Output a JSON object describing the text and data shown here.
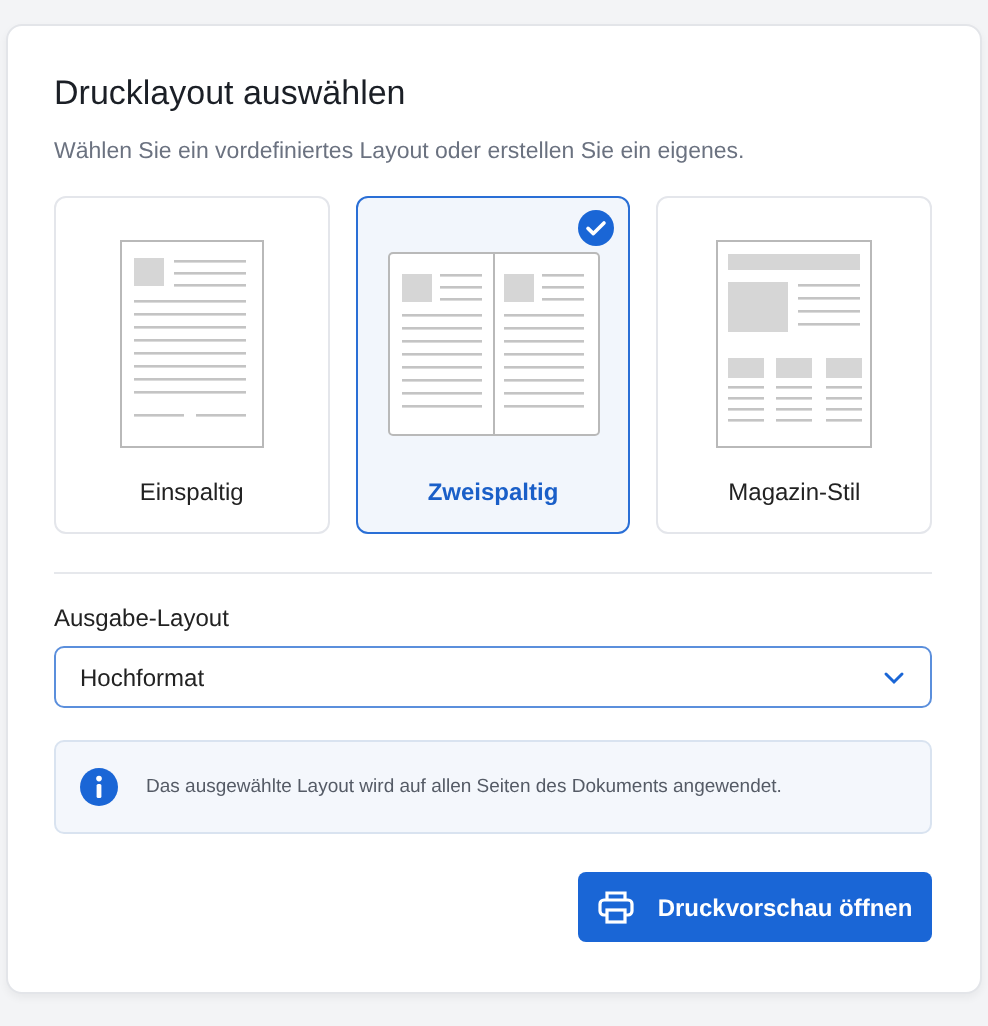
{
  "dialog": {
    "title": "Drucklayout auswählen",
    "subtitle": "Wählen Sie ein vordefiniertes Layout oder erstellen Sie ein eigenes."
  },
  "layouts": [
    {
      "kind": "single",
      "label": "Einspaltig",
      "selected": false
    },
    {
      "kind": "double",
      "label": "Zweispaltig",
      "selected": true
    },
    {
      "kind": "magazine",
      "label": "Magazin-Stil",
      "selected": false
    }
  ],
  "output": {
    "label": "Ausgabe-Layout",
    "value": "Hochformat"
  },
  "info": {
    "text": "Das ausgewählte Layout wird auf allen Seiten des Dokuments angewendet."
  },
  "buttons": [
    {
      "label": "Druckvorschau öffnen"
    }
  ]
}
